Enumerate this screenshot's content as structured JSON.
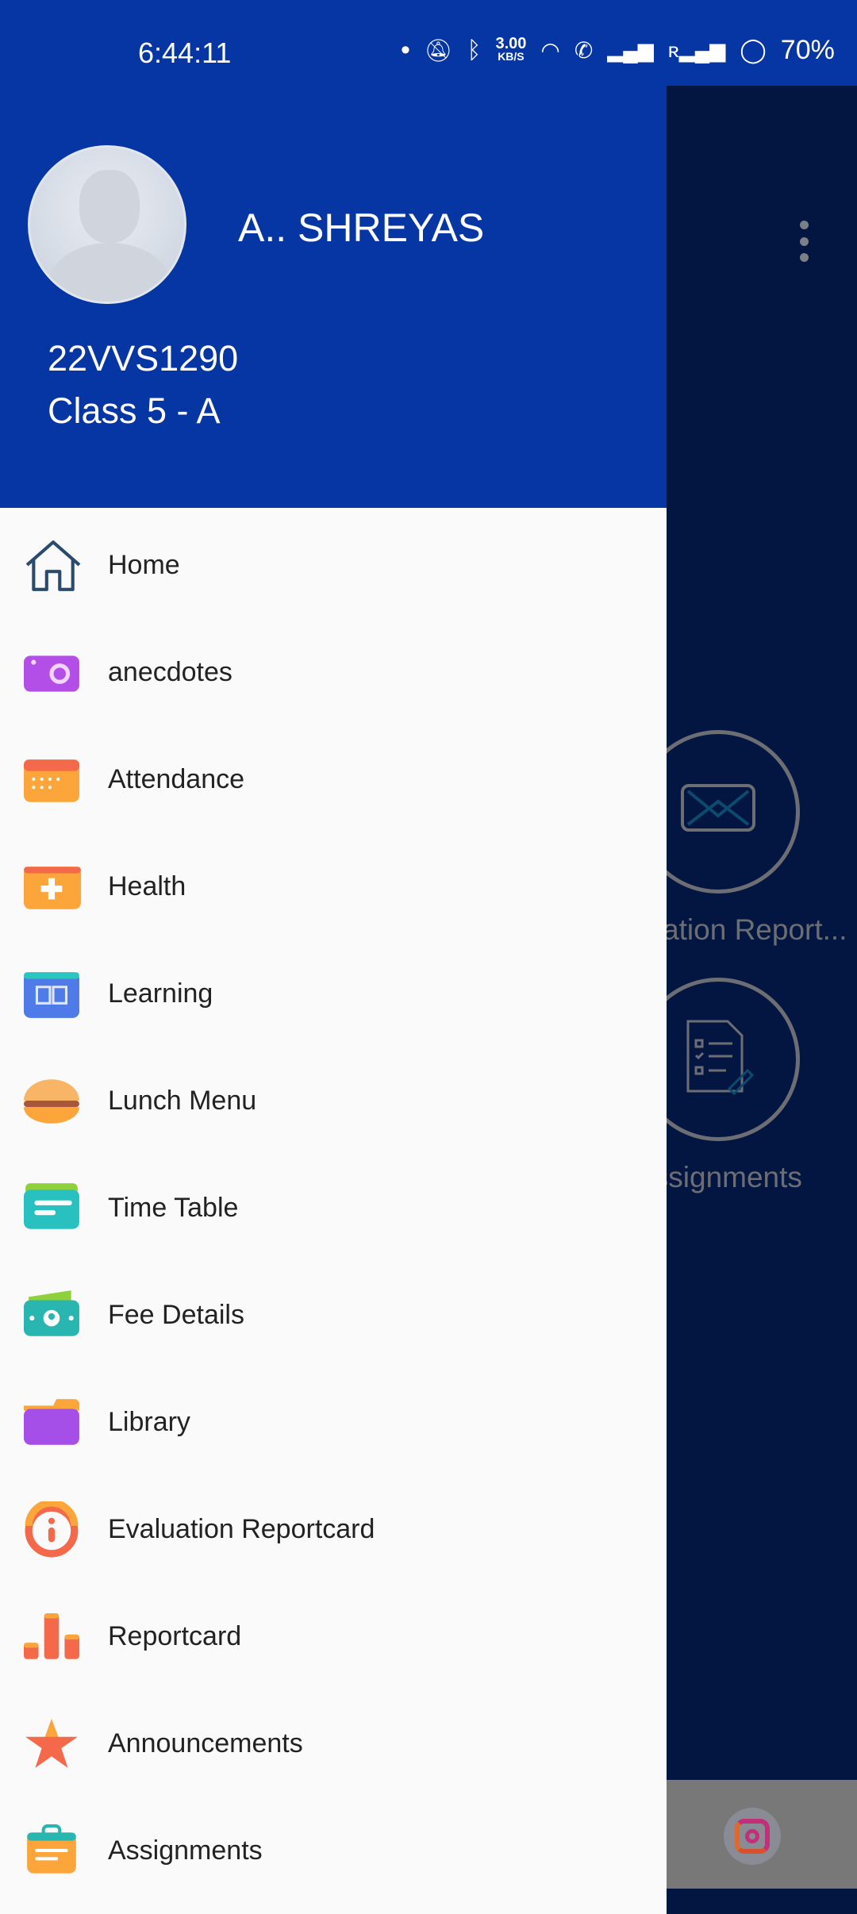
{
  "status_bar": {
    "time": "6:44:11",
    "speed_value": "3.00",
    "speed_unit": "KB/S",
    "battery": "70%"
  },
  "background_app": {
    "tiles": [
      {
        "label": "Evaluation Report...",
        "icon": "envelope-icon"
      },
      {
        "label": "Assignments",
        "icon": "checklist-icon"
      }
    ],
    "footer_icon": "instagram-icon"
  },
  "drawer": {
    "user": {
      "name": "A.. SHREYAS",
      "id": "22VVS1290",
      "class": "Class 5 - A"
    },
    "items": [
      {
        "label": "Home",
        "icon": "home-icon"
      },
      {
        "label": "anecdotes",
        "icon": "camera-icon"
      },
      {
        "label": "Attendance",
        "icon": "calendar-icon"
      },
      {
        "label": "Health",
        "icon": "first-aid-icon"
      },
      {
        "label": "Learning",
        "icon": "book-icon"
      },
      {
        "label": "Lunch Menu",
        "icon": "burger-icon"
      },
      {
        "label": "Time Table",
        "icon": "timetable-icon"
      },
      {
        "label": "Fee Details",
        "icon": "money-icon"
      },
      {
        "label": "Library",
        "icon": "folder-icon"
      },
      {
        "label": "Evaluation Reportcard",
        "icon": "info-icon"
      },
      {
        "label": "Reportcard",
        "icon": "bar-chart-icon"
      },
      {
        "label": "Announcements",
        "icon": "star-icon"
      },
      {
        "label": "Assignments",
        "icon": "clipboard-icon"
      }
    ]
  },
  "colors": {
    "header": "#0636a3",
    "app_bg": "#031641",
    "drawer_bg": "#fafafa"
  }
}
